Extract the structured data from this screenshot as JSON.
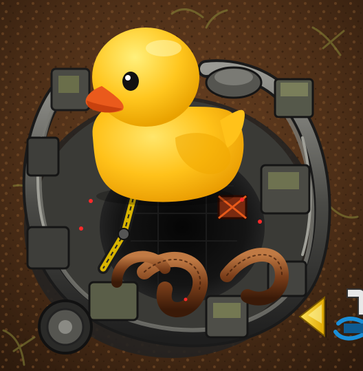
{
  "scene": {
    "ground": "dirt-ground",
    "structure": "rocket-silo",
    "sprite": "rubber-duck"
  },
  "icons": {
    "duck": "rubber-duck-icon",
    "arrow": "yellow-left-arrow-icon",
    "cursor": "blue-cursor-icon"
  },
  "colors": {
    "dirt_dark": "#3b2412",
    "dirt_mid": "#6a4122",
    "dirt_light": "#8a5a2e",
    "grass": "#8a8a3a",
    "metal_dark": "#2b2b2b",
    "metal": "#5a5a56",
    "metal_light": "#8c8c86",
    "copper": "#8a4a22",
    "duck_yellow": "#ffc21a",
    "duck_light": "#ffe25a",
    "beak": "#ea5a1c",
    "arrow_yellow": "#f5c400",
    "cursor_blue": "#1a8fd8",
    "led_red": "#ff2a2a"
  }
}
